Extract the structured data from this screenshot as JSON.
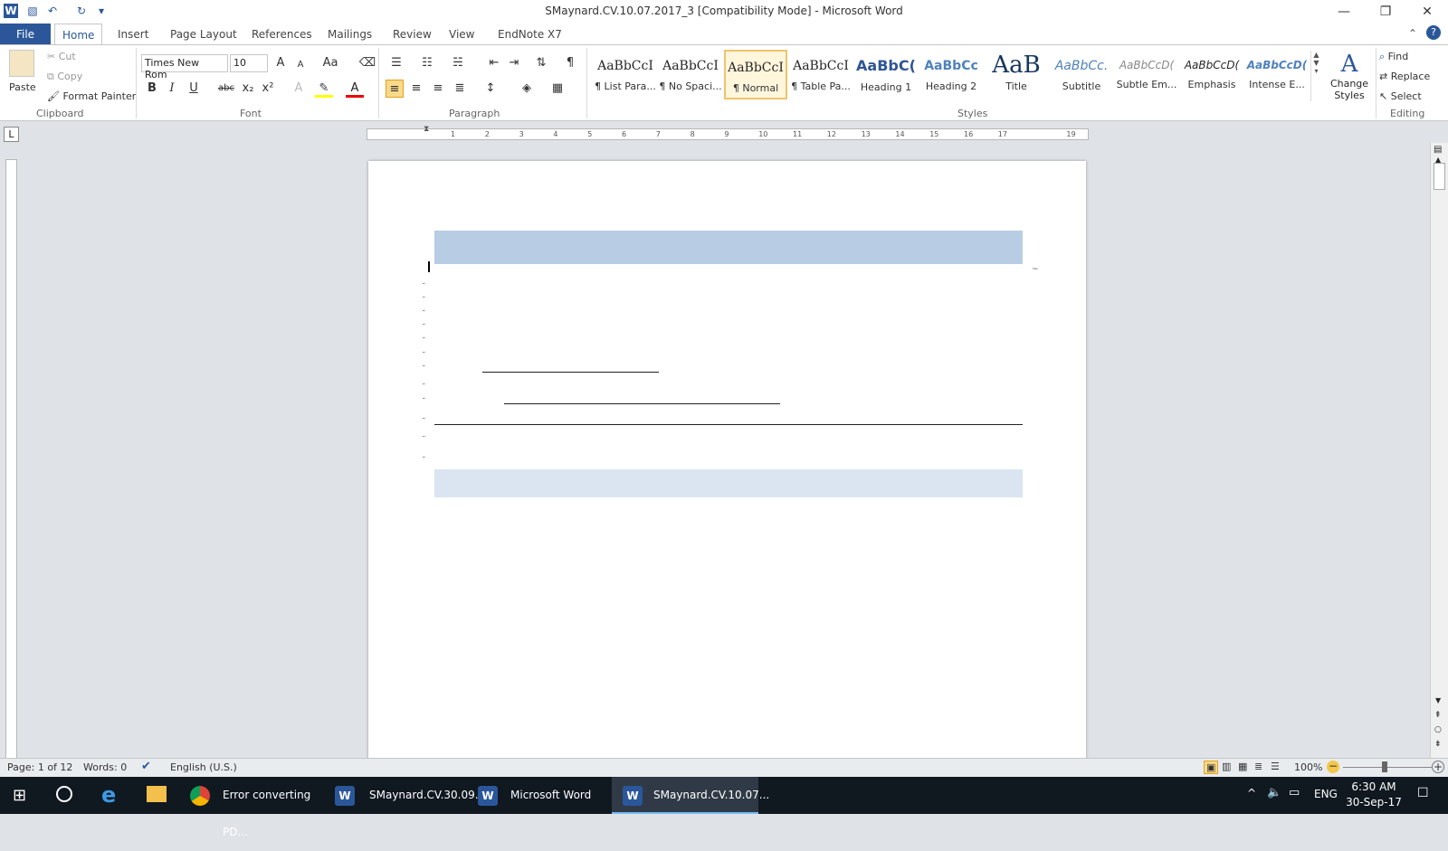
{
  "window": {
    "title": "SMaynard.CV.10.07.2017_3 [Compatibility Mode]  -  Microsoft Word",
    "controls": {
      "minimize": "—",
      "restore": "❐",
      "close": "✕"
    }
  },
  "qat": {
    "word_icon": "W",
    "save_icon": "💾",
    "undo_icon": "↶",
    "redo_icon": "↻",
    "customize_icon": "▾"
  },
  "tabs": [
    "File",
    "Home",
    "Insert",
    "Page Layout",
    "References",
    "Mailings",
    "Review",
    "View",
    "EndNote X7"
  ],
  "clipboard": {
    "paste": "Paste",
    "cut": "Cut",
    "copy": "Copy",
    "format_painter": "Format Painter",
    "label": "Clipboard"
  },
  "font": {
    "name": "Times New Rom",
    "size": "10",
    "label": "Font",
    "grow": "A",
    "shrink": "A",
    "change_case": "Aa",
    "bold": "B",
    "italic": "I",
    "underline": "U",
    "strike": "abc",
    "subscript": "x₂",
    "superscript": "x²"
  },
  "paragraph": {
    "label": "Paragraph",
    "pilcrow": "¶"
  },
  "styles": {
    "label": "Styles",
    "items": [
      {
        "preview": "AaBbCcI",
        "name": "¶ List Para..."
      },
      {
        "preview": "AaBbCcI",
        "name": "¶ No Spaci..."
      },
      {
        "preview": "AaBbCcI",
        "name": "¶ Normal"
      },
      {
        "preview": "AaBbCcI",
        "name": "¶ Table Pa..."
      },
      {
        "preview": "AaBbC(",
        "name": "Heading 1"
      },
      {
        "preview": "AaBbCc",
        "name": "Heading 2"
      },
      {
        "preview": "AaB",
        "name": "Title"
      },
      {
        "preview": "AaBbCc.",
        "name": "Subtitle"
      },
      {
        "preview": "AaBbCcD(",
        "name": "Subtle Em..."
      },
      {
        "preview": "AaBbCcD(",
        "name": "Emphasis"
      },
      {
        "preview": "AaBbCcD(",
        "name": "Intense E..."
      }
    ],
    "change_styles": "Change Styles"
  },
  "editing": {
    "label": "Editing",
    "find": "Find",
    "replace": "Replace",
    "select": "Select"
  },
  "status": {
    "page": "Page: 1 of 12",
    "words": "Words: 0",
    "language": "English (U.S.)",
    "zoom": "100%"
  },
  "taskbar": {
    "items": [
      {
        "label": "Error converting PD...",
        "icon": "chrome"
      },
      {
        "label": "SMaynard.CV.30.09....",
        "icon": "W"
      },
      {
        "label": "Microsoft Word",
        "icon": "W"
      },
      {
        "label": "SMaynard.CV.10.07...",
        "icon": "W"
      }
    ],
    "lang": "ENG",
    "time": "6:30 AM",
    "date": "30-Sep-17"
  },
  "ruler_numbers": [
    "1",
    "2",
    "3",
    "4",
    "5",
    "6",
    "7",
    "8",
    "9",
    "10",
    "11",
    "12",
    "13",
    "14",
    "15",
    "16",
    "17",
    "19"
  ]
}
